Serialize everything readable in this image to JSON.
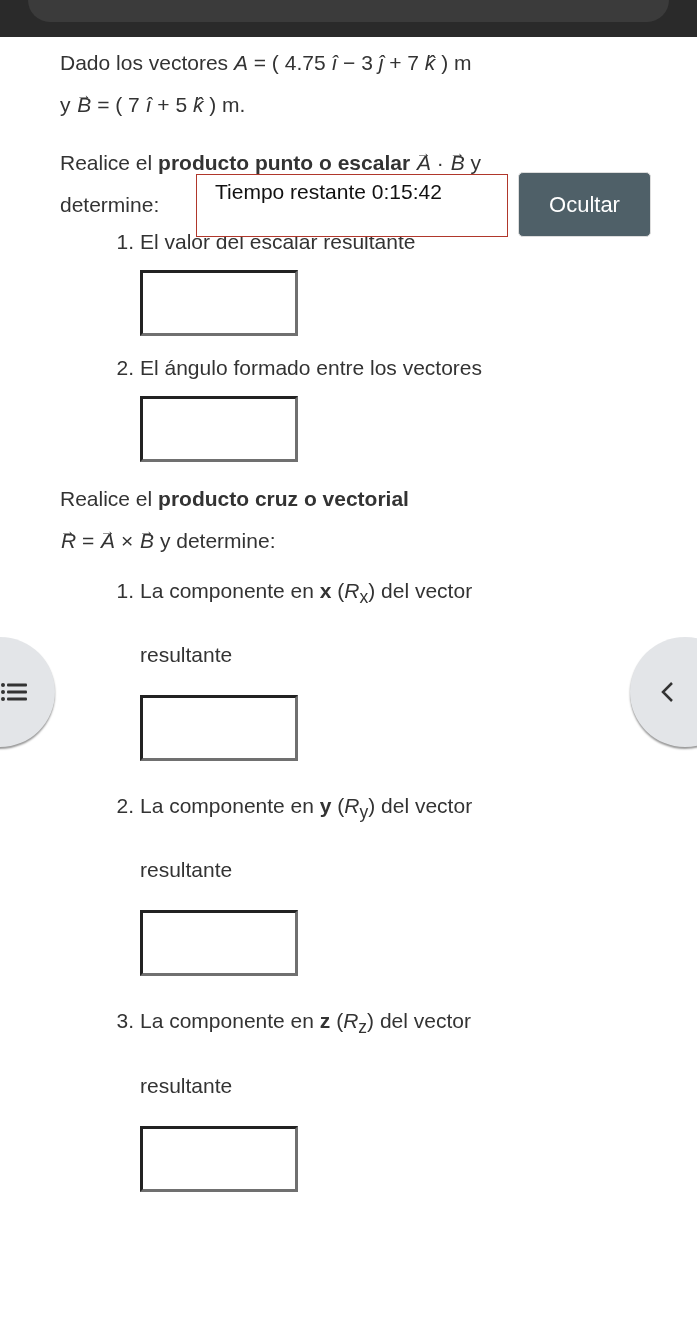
{
  "dot_product": {
    "intro": [
      "Dado los vectores  *A* = ( 4.75 *î* − 3 *ĵ* + 7 *k̂* ) m",
      "y  $^{→}$*B* = ( 7 *î* + 5 *k̂* ) m."
    ],
    "prompt": [
      "Realice el **producto punto o escalar** $^{→}$*A* · $^{→}$*B* y",
      "determine:"
    ],
    "questions": [
      {
        "number": "1.",
        "text": "El valor del escalar resultante"
      },
      {
        "number": "2.",
        "text": "El ángulo formado entre los vectores"
      }
    ]
  },
  "timer": {
    "text": "Tiempo restante 0:15:42"
  },
  "hide_button": {
    "label": "Ocultar"
  },
  "cross_product": {
    "prompt": [
      "Realice el **producto cruz o vectorial**",
      "$^{→}$*R* = $^{→}$*A* × $^{→}$*B*  y determine:"
    ],
    "questions": [
      {
        "number": "1.",
        "text": "La componente en **x** (*R*$_{x}$) del vector resultante"
      },
      {
        "number": "2.",
        "text": "La componente en **y** (*R*$_{y}$) del vector resultante"
      },
      {
        "number": "3.",
        "text": "La componente en **z** (*R*$_{z}$) del vector resultante"
      }
    ]
  }
}
